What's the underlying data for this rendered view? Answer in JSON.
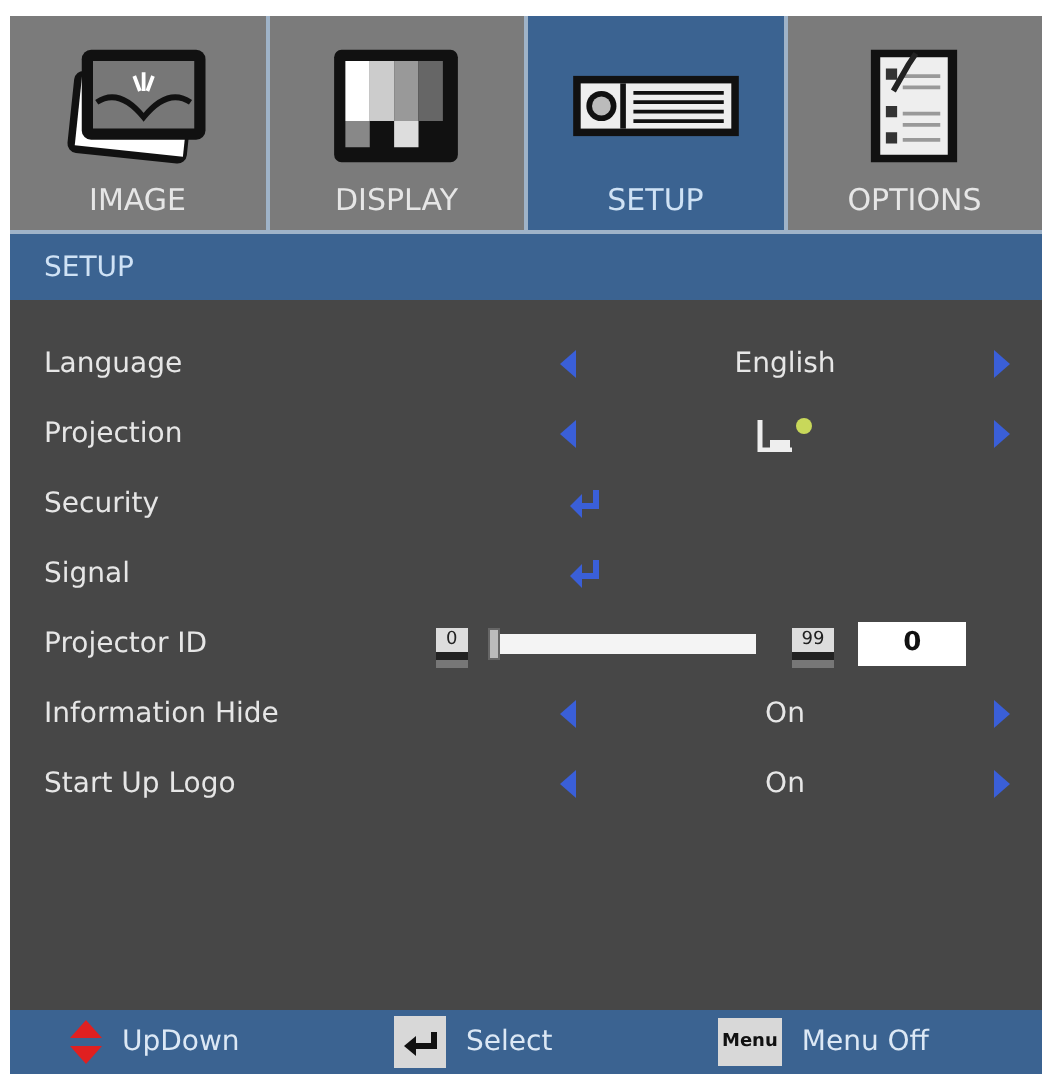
{
  "tabs": [
    {
      "label": "IMAGE",
      "selected": false
    },
    {
      "label": "DISPLAY",
      "selected": false
    },
    {
      "label": "SETUP",
      "selected": true
    },
    {
      "label": "OPTIONS",
      "selected": false
    }
  ],
  "header": "SETUP",
  "rows": [
    {
      "kind": "choice",
      "label": "Language",
      "value": "English"
    },
    {
      "kind": "projection",
      "label": "Projection"
    },
    {
      "kind": "enter",
      "label": "Security"
    },
    {
      "kind": "enter",
      "label": "Signal"
    },
    {
      "kind": "slider",
      "label": "Projector ID",
      "min": "0",
      "max": "99",
      "level": 0,
      "value": "0"
    },
    {
      "kind": "choice",
      "label": "Information Hide",
      "value": "On"
    },
    {
      "kind": "choice",
      "label": "Start Up Logo",
      "value": "On"
    }
  ],
  "footer": [
    {
      "kind": "updown",
      "label": "UpDown"
    },
    {
      "kind": "enter",
      "label": "Select"
    },
    {
      "kind": "menu",
      "key": "Menu",
      "label": "Menu Off"
    }
  ]
}
